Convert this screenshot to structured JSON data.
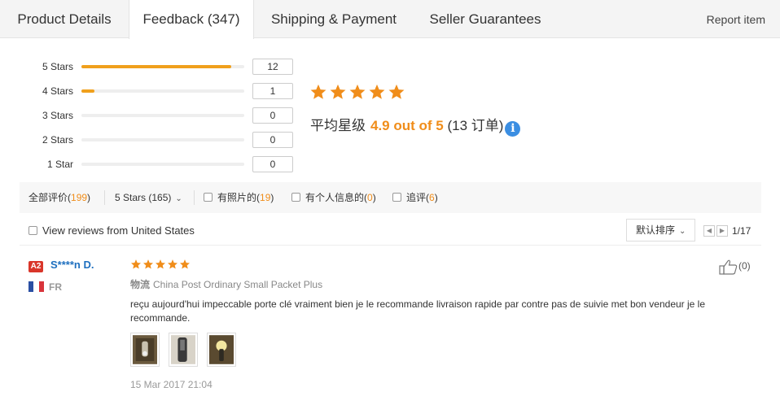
{
  "tabs": [
    {
      "label": "Product Details",
      "active": false
    },
    {
      "label": "Feedback (347)",
      "active": true
    },
    {
      "label": "Shipping & Payment",
      "active": false
    },
    {
      "label": "Seller Guarantees",
      "active": false
    }
  ],
  "report_label": "Report item",
  "histogram": [
    {
      "label": "5 Stars",
      "count": "12",
      "fraction": 0.92
    },
    {
      "label": "4 Stars",
      "count": "1",
      "fraction": 0.08
    },
    {
      "label": "3 Stars",
      "count": "0",
      "fraction": 0
    },
    {
      "label": "2 Stars",
      "count": "0",
      "fraction": 0
    },
    {
      "label": "1 Star",
      "count": "0",
      "fraction": 0
    }
  ],
  "summary": {
    "stars": 5,
    "avg_label": "平均星级",
    "score_text": "4.9 out of 5",
    "orders_text": "(13 订单)",
    "info_icon": "info-icon",
    "star_color": "#f08d1a"
  },
  "filters": {
    "all_label": "全部评价",
    "all_count_open": "(",
    "all_count": "199",
    "all_count_close": ")",
    "stars_filter": "5 Stars (165)",
    "photo_label": "有照片的",
    "photo_count_open": "(",
    "photo_count": "19",
    "photo_count_close": ")",
    "personal_label": "有个人信息的",
    "personal_count_open": "(",
    "personal_count": "0",
    "personal_count_close": ")",
    "followup_label": "追评",
    "followup_count_open": "(",
    "followup_count": "6",
    "followup_count_close": ")"
  },
  "view": {
    "view_from_label": "View reviews from United States",
    "sort_label": "默认排序",
    "pager_text": "1/17"
  },
  "review": {
    "badge": "A2",
    "username": "S****n D.",
    "country": "FR",
    "rating": 5,
    "logistics_label": "物流",
    "logistics_value": "China Post Ordinary Small Packet Plus",
    "text": "reçu aujourd'hui impeccable porte clé vraiment bien je le recommande livraison rapide par contre pas de suivie met bon vendeur je le recommande.",
    "date": "15 Mar 2017 21:04",
    "likes": "(0)",
    "photos": 3
  }
}
